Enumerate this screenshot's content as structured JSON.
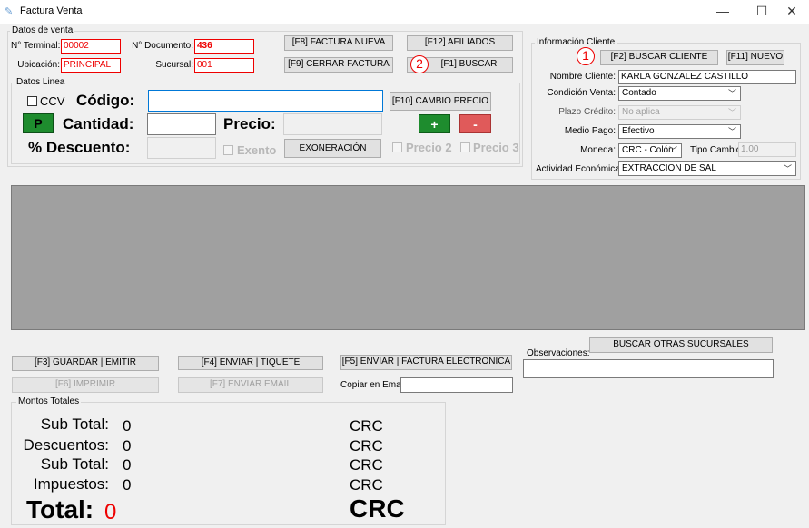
{
  "window": {
    "title": "Factura Venta",
    "minimize": "—",
    "maximize": "☐",
    "close": "✕"
  },
  "venta": {
    "legend": "Datos de venta",
    "terminal_label": "N° Terminal:",
    "terminal_value": "00002",
    "documento_label": "N° Documento:",
    "documento_value": "436",
    "ubicacion_label": "Ubicación:",
    "ubicacion_value": "PRINCIPAL",
    "sucursal_label": "Sucursal:",
    "sucursal_value": "001"
  },
  "toolbar": {
    "factura_nueva": "[F8] FACTURA NUEVA",
    "afiliados": "[F12] AFILIADOS",
    "cerrar_factura": "[F9] CERRAR FACTURA",
    "buscar": "[F1] BUSCAR"
  },
  "linea": {
    "legend": "Datos Linea",
    "ccv_label": "CCV",
    "codigo_label": "Código:",
    "codigo_value": "",
    "cambio_precio": "[F10] CAMBIO PRECIO",
    "p_button": "P",
    "cantidad_label": "Cantidad:",
    "cantidad_value": "",
    "precio_label": "Precio:",
    "plus_button": "+",
    "minus_button": "-",
    "descuento_label": "% Descuento:",
    "exento_label": "Exento",
    "exoneracion": "EXONERACIÓN",
    "precio2_label": "Precio 2",
    "precio3_label": "Precio 3"
  },
  "cliente": {
    "legend": "Información Cliente",
    "buscar_cliente": "[F2] BUSCAR CLIENTE",
    "nuevo": "[F11] NUEVO",
    "nombre_label": "Nombre Cliente:",
    "nombre_value": "KARLA GONZALEZ CASTILLO",
    "condicion_label": "Condición Venta:",
    "condicion_value": "Contado",
    "plazo_label": "Plazo Crédito:",
    "plazo_value": "No aplica",
    "medio_label": "Medio Pago:",
    "medio_value": "Efectivo",
    "moneda_label": "Moneda:",
    "moneda_value": "CRC - Colón",
    "tipo_cambio_label": "Tipo Cambio:",
    "tipo_cambio_value": "1.00",
    "actividad_label": "Actividad Económica:",
    "actividad_value": "EXTRACCION DE SAL"
  },
  "annotations": {
    "one": "1",
    "two": "2"
  },
  "actions": {
    "guardar": "[F3] GUARDAR | EMITIR",
    "enviar_tiquete": "[F4] ENVIAR | TIQUETE",
    "enviar_factura": "[F5] ENVIAR | FACTURA ELECTRONICA",
    "imprimir": "[F6] IMPRIMIR",
    "enviar_email": "[F7] ENVIAR EMAIL",
    "copiar_label": "Copiar en Email:",
    "copiar_value": "",
    "observaciones_label": "Observaciones:",
    "observaciones_value": "",
    "buscar_sucursales": "BUSCAR OTRAS SUCURSALES"
  },
  "totales": {
    "legend": "Montos Totales",
    "rows": [
      {
        "label": "Sub Total:",
        "value": "0",
        "currency": "CRC"
      },
      {
        "label": "Descuentos:",
        "value": "0",
        "currency": "CRC"
      },
      {
        "label": "Sub Total:",
        "value": "0",
        "currency": "CRC"
      },
      {
        "label": "Impuestos:",
        "value": "0",
        "currency": "CRC"
      }
    ],
    "total_label": "Total:",
    "total_value": "0",
    "total_currency": "CRC"
  },
  "colors": {
    "accent_red": "#e00000",
    "green": "#1e8c2e",
    "red_btn": "#e05a5a",
    "grid_gray": "#a0a0a0"
  }
}
